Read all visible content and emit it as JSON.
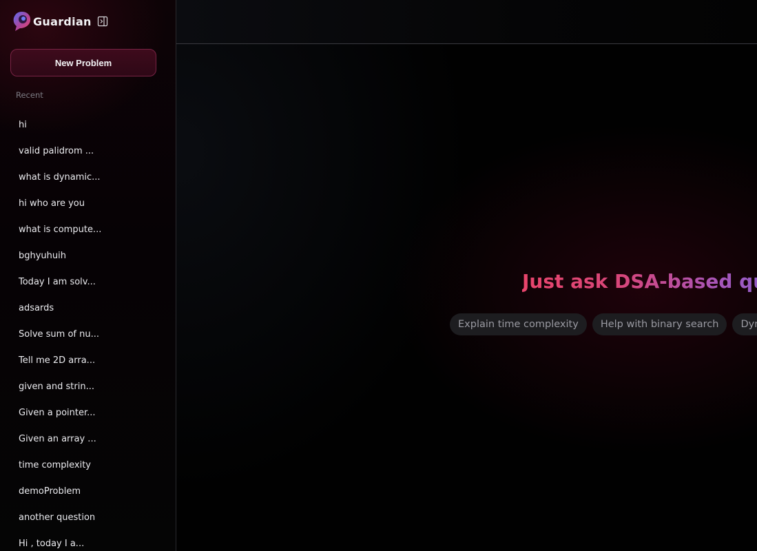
{
  "sidebar": {
    "brand_name": "Guardian",
    "new_problem_label": "New Problem",
    "recent_label": "Recent",
    "recent_items": [
      "hi",
      "valid palidrom ...",
      "what is dynamic...",
      "hi who are you",
      "what is compute...",
      "bghyuhuih",
      "Today I am solv...",
      "adsards",
      "Solve sum of nu...",
      "Tell me 2D arra...",
      "given and strin...",
      "Given a pointer...",
      "Given an array ...",
      "time complexity",
      "demoProblem",
      "another question",
      "Hi , today I a..."
    ]
  },
  "main": {
    "hero_title": "Just ask DSA-based questions",
    "suggestions": [
      "Explain time complexity",
      "Help with binary search",
      "Dynamic programming"
    ]
  },
  "colors": {
    "accent": "#e8456c",
    "accent_secondary": "#6e6ee8",
    "button_border": "#7a2345",
    "button_bg": "#3e0b1c"
  }
}
